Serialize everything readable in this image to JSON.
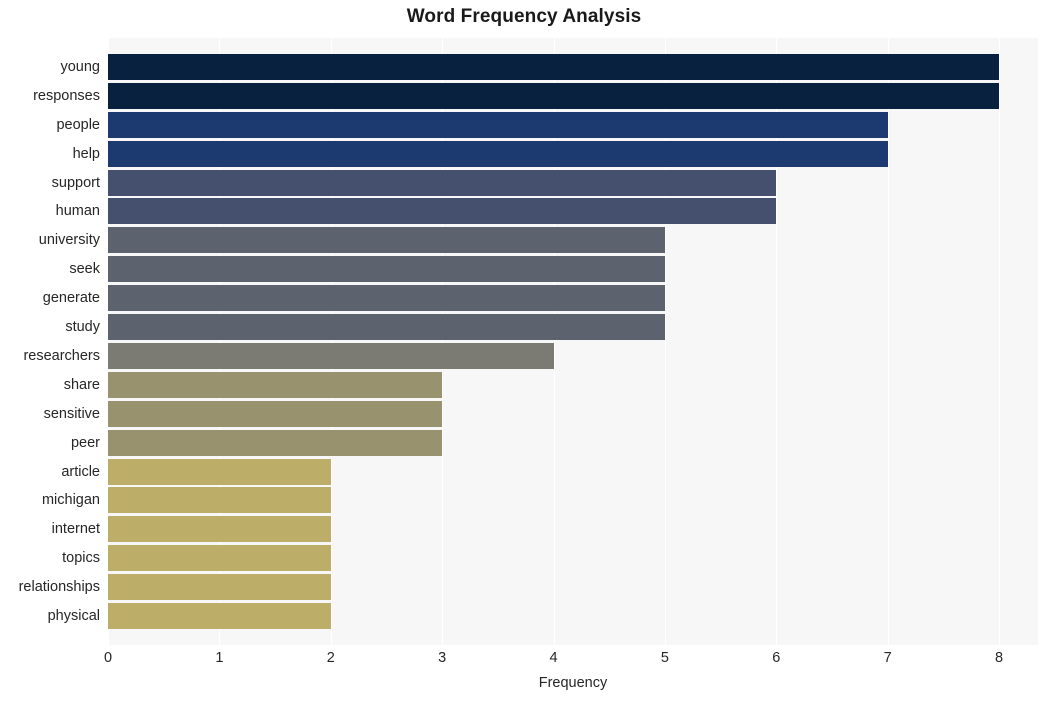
{
  "chart_data": {
    "type": "bar",
    "orientation": "horizontal",
    "title": "Word Frequency Analysis",
    "xlabel": "Frequency",
    "ylabel": "",
    "xlim": [
      0,
      8.35
    ],
    "ylim": [
      0,
      21
    ],
    "grid": true,
    "legend": false,
    "xticks": [
      0,
      1,
      2,
      3,
      4,
      5,
      6,
      7,
      8
    ],
    "xtick_labels": [
      "0",
      "1",
      "2",
      "3",
      "4",
      "5",
      "6",
      "7",
      "8"
    ],
    "categories": [
      "young",
      "responses",
      "people",
      "help",
      "support",
      "human",
      "university",
      "seek",
      "generate",
      "study",
      "researchers",
      "share",
      "sensitive",
      "peer",
      "article",
      "michigan",
      "internet",
      "topics",
      "relationships",
      "physical"
    ],
    "values": [
      8,
      8,
      7,
      7,
      6,
      6,
      5,
      5,
      5,
      5,
      4,
      3,
      3,
      3,
      2,
      2,
      2,
      2,
      2,
      2
    ],
    "bar_colors": [
      "#07213f",
      "#07213f",
      "#1d3a70",
      "#1d3a70",
      "#454f6e",
      "#454f6e",
      "#5d626f",
      "#5d626f",
      "#5d626f",
      "#5d626f",
      "#7b7b74",
      "#98926f",
      "#98926f",
      "#98926f",
      "#bcad68",
      "#bcad68",
      "#bcad68",
      "#bcad68",
      "#bcad68",
      "#bcad68"
    ],
    "plot_background": "#f7f7f8",
    "figure_background": "#ffffff",
    "gridline_color": "#ffffff",
    "text_color": "#262626"
  }
}
